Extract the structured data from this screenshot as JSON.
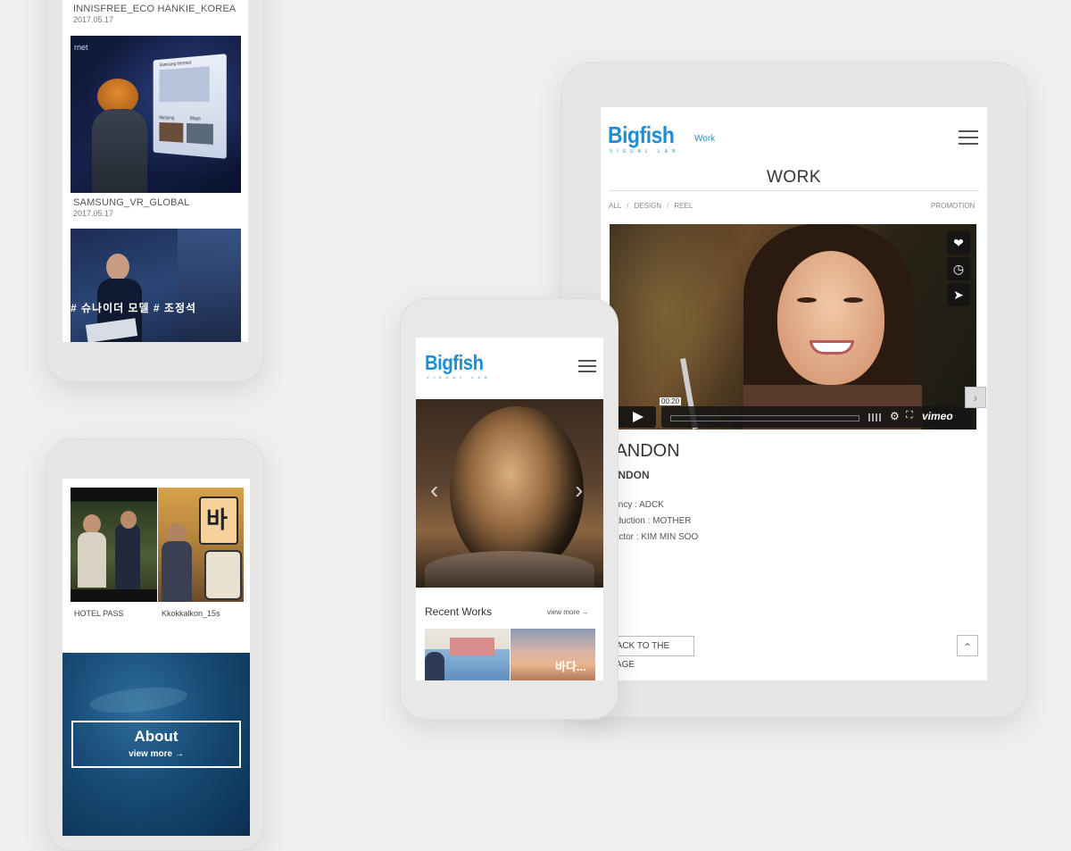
{
  "phone_list": {
    "items": [
      {
        "title": "INNISFREE_ECO HANKIE_KOREA",
        "date": "2017.05.17"
      },
      {
        "title": "SAMSUNG_VR_GLOBAL",
        "date": "2017.05.17"
      }
    ],
    "vr_overlay": {
      "brand": "rnet",
      "panel_title": "Samsung Internet",
      "tab1": "Mahjong",
      "tab2": "Maps"
    },
    "korean_caption": "# 슈나이더 모델 # 조정석"
  },
  "phone_about": {
    "works": [
      {
        "title": "HOTEL PASS"
      },
      {
        "title": "Kkokkalkon_15s"
      }
    ],
    "about_title": "About",
    "about_link": "view more →"
  },
  "phone_home": {
    "logo": "Bigfish",
    "logo_sub": "VISUAL LAB",
    "recent_title": "Recent Works",
    "recent_link": "view more →",
    "slider_prev": "‹",
    "slider_next": "›"
  },
  "tablet": {
    "logo": "Bigfish",
    "logo_sub": "VISUAL LAB",
    "nav_label": "Work",
    "page_title": "WORK",
    "filters": [
      "ALL",
      "DESIGN",
      "REEL"
    ],
    "filter_separator": "/",
    "filter_right": "PROMOTION",
    "video": {
      "time": "00:20",
      "provider": "vimeo"
    },
    "work_title": "HANDON",
    "work_subtitle": "HANDON",
    "credits": [
      "Agency : ADCK",
      "Production : MOTHER",
      "Director : KIM MIN SOO"
    ],
    "back_button": "BACK TO THE PAGE",
    "top_button": "⌃"
  },
  "colors": {
    "brand": "#1b8ed6",
    "background": "#efefef",
    "device": "#e6e6e6"
  }
}
